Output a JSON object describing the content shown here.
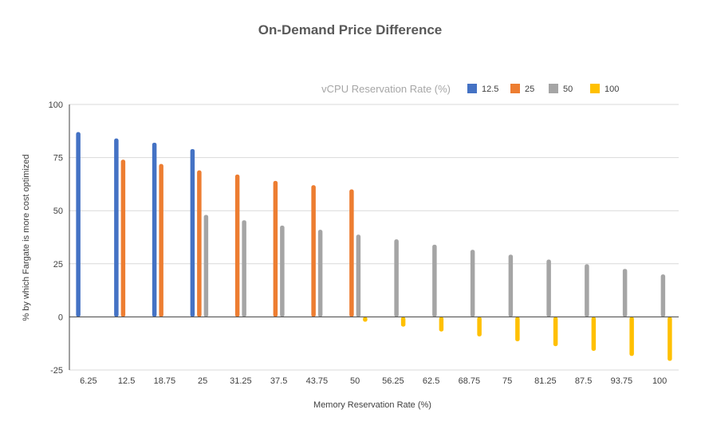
{
  "chart_data": {
    "type": "bar",
    "title": "On-Demand Price Difference",
    "xlabel": "Memory Reservation Rate (%)",
    "ylabel": "% by which Fargate is more cost optimized",
    "ylim": [
      -25,
      100
    ],
    "yticks": [
      100,
      75,
      50,
      25,
      0,
      -25
    ],
    "grid": true,
    "legend": {
      "title": "vCPU Reservation Rate (%)",
      "position": "top-right"
    },
    "categories": [
      "6.25",
      "12.5",
      "18.75",
      "25",
      "31.25",
      "37.5",
      "43.75",
      "50",
      "56.25",
      "62.5",
      "68.75",
      "75",
      "81.25",
      "87.5",
      "93.75",
      "100"
    ],
    "series": [
      {
        "name": "12.5",
        "color": "#4472c4",
        "values": [
          87,
          84,
          82,
          79,
          null,
          null,
          null,
          null,
          null,
          null,
          null,
          null,
          null,
          null,
          null,
          null
        ]
      },
      {
        "name": "25",
        "color": "#ed7d31",
        "values": [
          null,
          74,
          72,
          69,
          67,
          64,
          62,
          60,
          null,
          null,
          null,
          null,
          null,
          null,
          null,
          null
        ]
      },
      {
        "name": "50",
        "color": "#a5a5a5",
        "values": [
          null,
          null,
          null,
          48,
          45.5,
          43,
          41,
          38.7,
          36.5,
          34,
          31.6,
          29.3,
          27,
          24.8,
          22.6,
          20
        ]
      },
      {
        "name": "100",
        "color": "#ffc000",
        "values": [
          null,
          null,
          null,
          null,
          null,
          null,
          null,
          -2.3,
          -4.6,
          -6.9,
          -9.2,
          -11.5,
          -13.8,
          -16,
          -18.4,
          -20.7
        ]
      }
    ]
  }
}
